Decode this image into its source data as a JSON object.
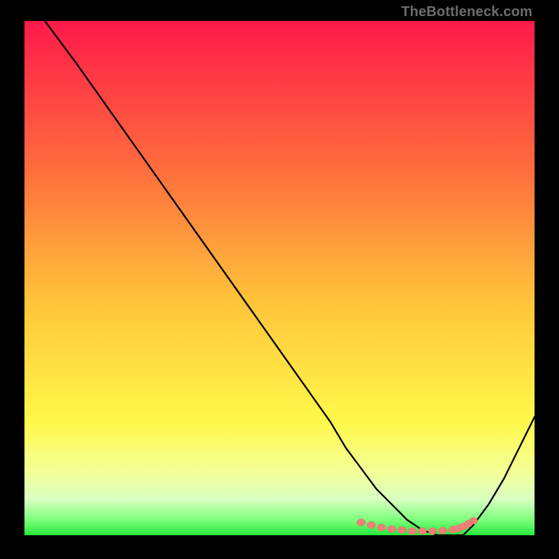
{
  "watermark": "TheBottleneck.com",
  "colors": {
    "bg_black": "#000000",
    "gradient_top": "#ff1a4b",
    "gradient_mid1": "#ff7a3a",
    "gradient_mid2": "#ffd23a",
    "gradient_mid3": "#f7ff5a",
    "gradient_bottom_band": "#eaffc8",
    "gradient_green": "#27e83a",
    "curve": "#000000",
    "dot_fill": "#f08078",
    "dot_stroke": "#d66b63"
  },
  "chart_data": {
    "type": "line",
    "title": "",
    "xlabel": "",
    "ylabel": "",
    "xlim": [
      0,
      100
    ],
    "ylim": [
      0,
      100
    ],
    "series": [
      {
        "name": "bottleneck-curve",
        "x": [
          4,
          10,
          15,
          20,
          25,
          30,
          35,
          40,
          45,
          50,
          55,
          60,
          63,
          66,
          69,
          72,
          75,
          78,
          81,
          84,
          86,
          88,
          91,
          94,
          97,
          100
        ],
        "y": [
          100,
          92,
          85,
          78,
          71,
          64,
          57,
          50,
          43,
          36,
          29,
          22,
          17,
          13,
          9,
          6,
          3,
          1,
          0,
          0,
          0,
          2,
          6,
          11,
          17,
          23
        ]
      }
    ],
    "highlight_points": {
      "name": "optimal-range-dots",
      "x": [
        66,
        68,
        70,
        72,
        74,
        76,
        78,
        80,
        82,
        84,
        85,
        86,
        87,
        88
      ],
      "y": [
        2.5,
        2.0,
        1.5,
        1.2,
        1.0,
        0.8,
        0.8,
        0.8,
        0.9,
        1.1,
        1.3,
        1.7,
        2.2,
        2.8
      ]
    }
  }
}
